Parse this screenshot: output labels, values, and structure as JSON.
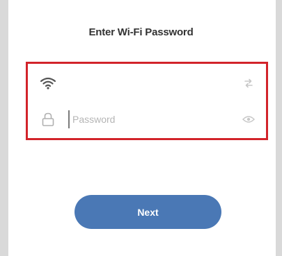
{
  "header": {
    "title": "Enter Wi-Fi Password"
  },
  "form": {
    "ssid_icon": "wifi-icon",
    "ssid_value": "",
    "ssid_action_icon": "switch-network-icon",
    "password_icon": "lock-icon",
    "password_placeholder": "Password",
    "password_value": "",
    "password_action_icon": "eye-icon"
  },
  "actions": {
    "next_label": "Next"
  },
  "colors": {
    "highlight": "#d2232a",
    "button": "#4a78b5",
    "side_bars": "#d9d9d9"
  }
}
